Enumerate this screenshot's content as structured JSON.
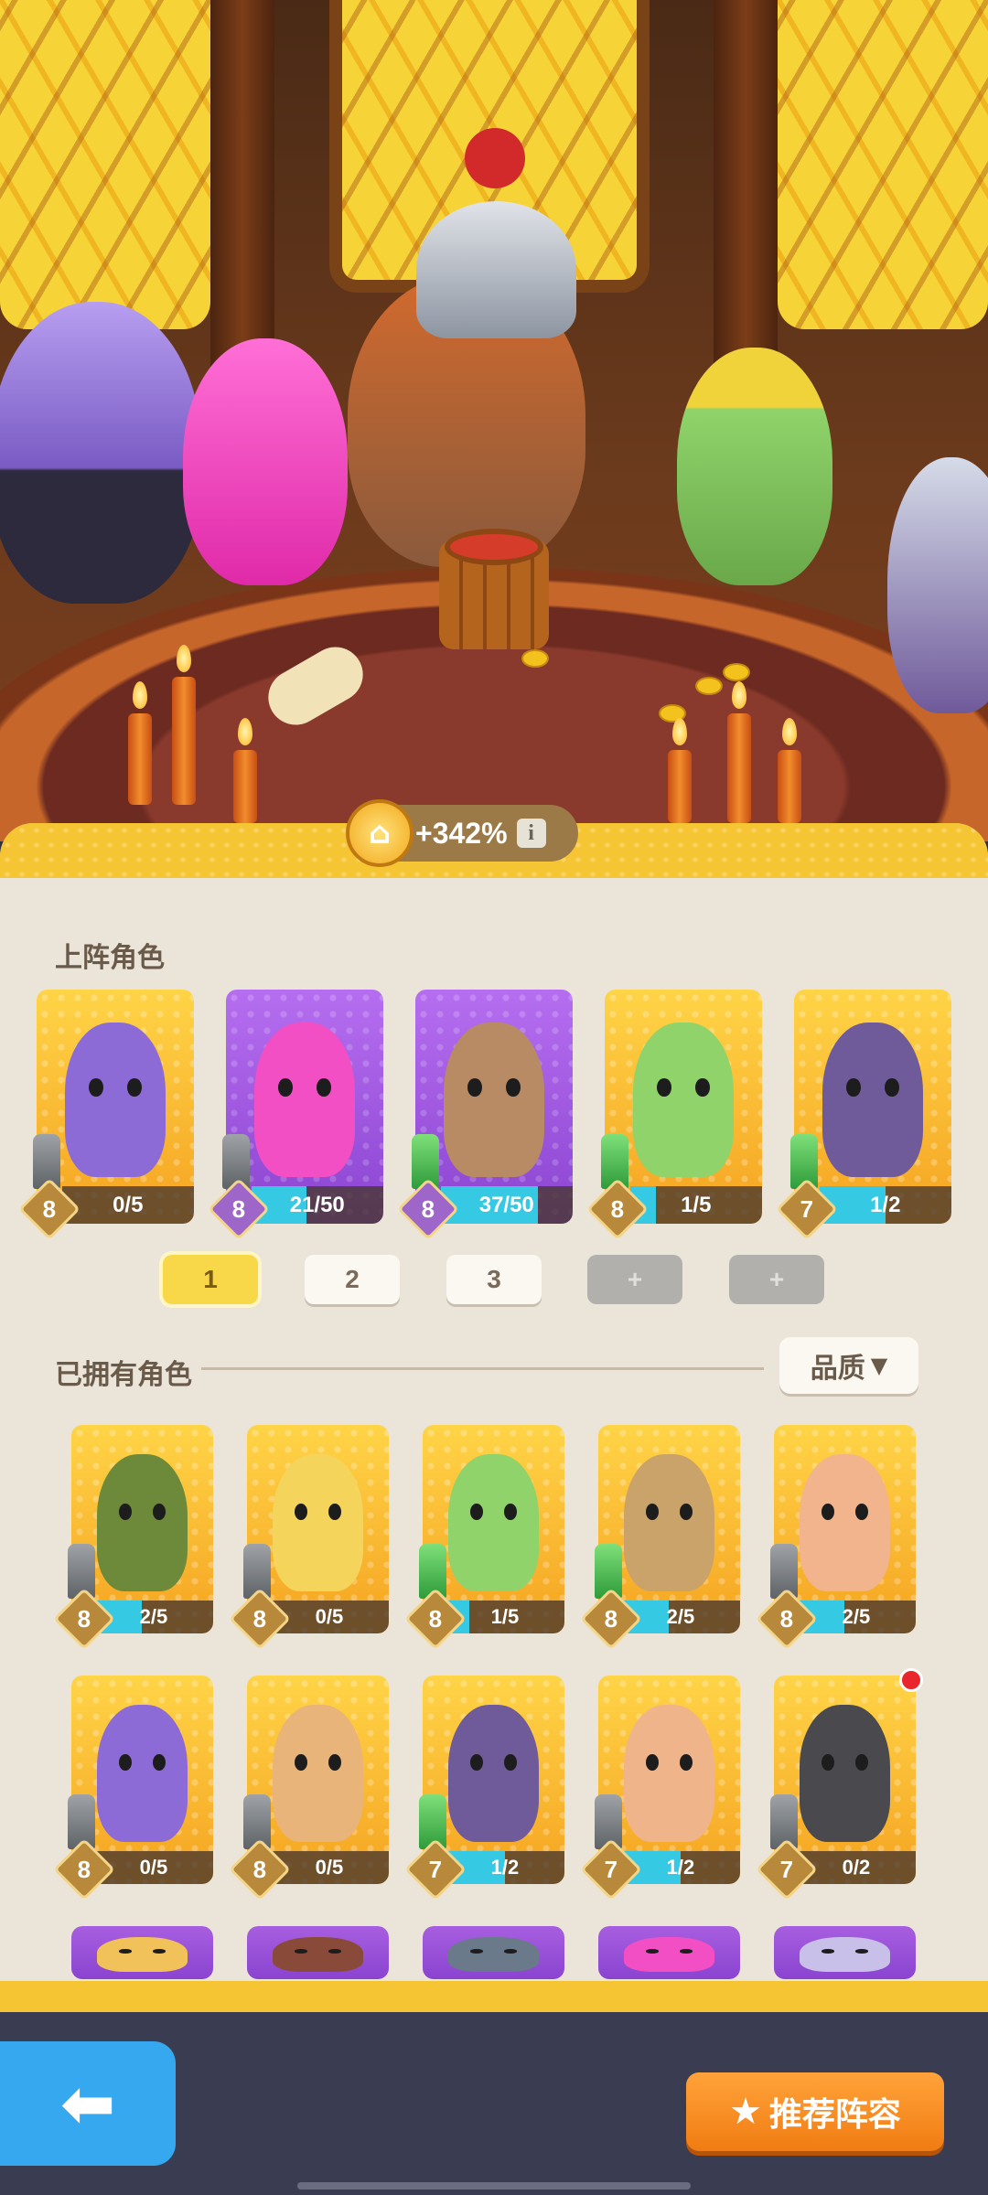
{
  "bonus": {
    "text": "+342%",
    "info_icon": "i"
  },
  "sections": {
    "deployed": "上阵角色",
    "owned": "已拥有角色"
  },
  "sort": {
    "label": "品质",
    "arrow": "▼"
  },
  "deployed": [
    {
      "level": "8",
      "progress_text": "0/5",
      "progress": 0,
      "frame": "gold",
      "gem": "gray",
      "color": "#8d6bd6"
    },
    {
      "level": "8",
      "progress_text": "21/50",
      "progress": 0.42,
      "frame": "purple",
      "gem": "gray",
      "color": "#f24fc4"
    },
    {
      "level": "8",
      "progress_text": "37/50",
      "progress": 0.74,
      "frame": "purple",
      "gem": "green",
      "color": "#b98b64"
    },
    {
      "level": "8",
      "progress_text": "1/5",
      "progress": 0.2,
      "frame": "gold",
      "gem": "green",
      "color": "#8fd36a"
    },
    {
      "level": "7",
      "progress_text": "1/2",
      "progress": 0.5,
      "frame": "gold",
      "gem": "green",
      "color": "#6f5a9a"
    }
  ],
  "teams": [
    {
      "label": "1",
      "state": "active"
    },
    {
      "label": "2",
      "state": "normal"
    },
    {
      "label": "3",
      "state": "normal"
    },
    {
      "label": "+",
      "state": "locked"
    },
    {
      "label": "+",
      "state": "locked"
    }
  ],
  "owned": [
    {
      "level": "8",
      "progress_text": "2/5",
      "progress": 0.4,
      "gem": "gray",
      "color": "#6d8a3a",
      "dot": false
    },
    {
      "level": "8",
      "progress_text": "0/5",
      "progress": 0,
      "gem": "gray",
      "color": "#f4d45a",
      "dot": false
    },
    {
      "level": "8",
      "progress_text": "1/5",
      "progress": 0.2,
      "gem": "green",
      "color": "#8fd36a",
      "dot": false
    },
    {
      "level": "8",
      "progress_text": "2/5",
      "progress": 0.4,
      "gem": "green",
      "color": "#c9a36a",
      "dot": false
    },
    {
      "level": "8",
      "progress_text": "2/5",
      "progress": 0.4,
      "gem": "gray",
      "color": "#f2b48c",
      "dot": false
    },
    {
      "level": "8",
      "progress_text": "0/5",
      "progress": 0,
      "gem": "gray",
      "color": "#8d6bd6",
      "dot": false
    },
    {
      "level": "8",
      "progress_text": "0/5",
      "progress": 0,
      "gem": "gray",
      "color": "#e8b47a",
      "dot": false
    },
    {
      "level": "7",
      "progress_text": "1/2",
      "progress": 0.5,
      "gem": "green",
      "color": "#6f5a9a",
      "dot": false
    },
    {
      "level": "7",
      "progress_text": "1/2",
      "progress": 0.5,
      "gem": "gray",
      "color": "#f0b48a",
      "dot": false
    },
    {
      "level": "7",
      "progress_text": "0/2",
      "progress": 0,
      "gem": "gray",
      "color": "#4a4a4e",
      "dot": true
    }
  ],
  "buttons": {
    "recommend": "推荐阵容",
    "back": "back"
  },
  "icons": {
    "back": "back-arrow-icon",
    "recommend": "star-icon",
    "bonus": "bonus-medal-icon",
    "info": "info-icon"
  },
  "colors": {
    "accent": "#f6c533",
    "progress": "#36c9e3",
    "recommend": "#f07c12",
    "back": "#35a8f0"
  }
}
